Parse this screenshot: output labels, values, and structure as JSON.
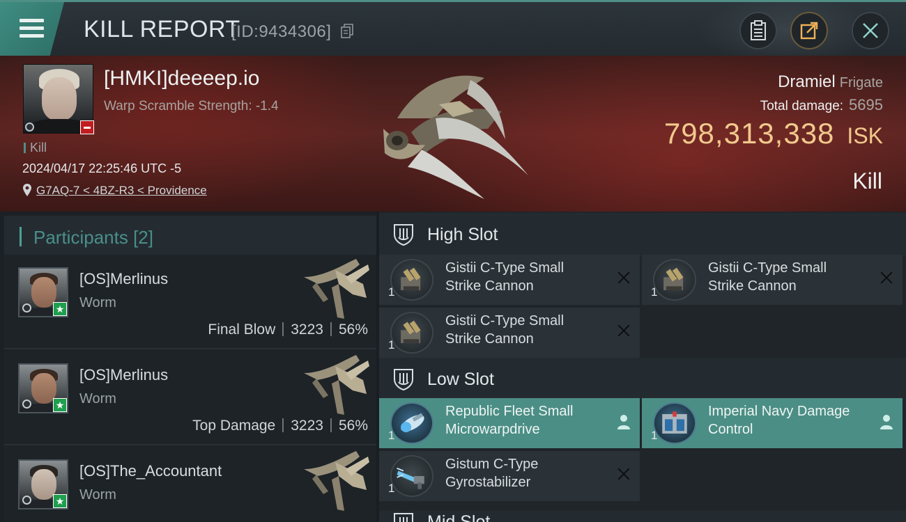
{
  "header": {
    "title": "KILL REPORT",
    "report_id": "[ID:9434306]"
  },
  "victim": {
    "name": "[HMKI]deeeep.io",
    "warp_scramble": "Warp Scramble Strength: -1.4",
    "kill_label": "Kill",
    "timestamp": "2024/04/17 22:25:46 UTC -5",
    "location": "G7AQ-7 < 4BZ-R3 < Providence",
    "ship_name": "Dramiel",
    "ship_class": "Frigate",
    "total_damage_label": "Total damage:",
    "total_damage": "5695",
    "isk_value": "798,313,338",
    "isk_unit": "ISK",
    "result": "Kill",
    "standing_color": "#c21d20"
  },
  "participants": {
    "title": "Participants",
    "count": "[2]",
    "rows": [
      {
        "name": "[OS]Merlinus",
        "ship": "Worm",
        "role": "Final Blow",
        "damage": "3223",
        "percent": "56%"
      },
      {
        "name": "[OS]Merlinus",
        "ship": "Worm",
        "role": "Top Damage",
        "damage": "3223",
        "percent": "56%"
      },
      {
        "name": "[OS]The_Accountant",
        "ship": "Worm"
      }
    ]
  },
  "fitting": {
    "high_slot_label": "High Slot",
    "low_slot_label": "Low Slot",
    "mid_slot_label": "Mid Slot",
    "high_slot": [
      {
        "qty": "1",
        "name": "Gistii C-Type Small Strike Cannon",
        "state": "destroyed"
      },
      {
        "qty": "1",
        "name": "Gistii C-Type Small Strike Cannon",
        "state": "destroyed"
      },
      {
        "qty": "1",
        "name": "Gistii C-Type Small Strike Cannon",
        "state": "destroyed"
      }
    ],
    "low_slot": [
      {
        "qty": "1",
        "name": "Republic Fleet Small Microwarpdrive",
        "state": "dropped"
      },
      {
        "qty": "1",
        "name": "Imperial Navy Damage Control",
        "state": "dropped"
      },
      {
        "qty": "1",
        "name": "Gistum C-Type Gyrostabilizer",
        "state": "destroyed"
      }
    ]
  },
  "colors": {
    "accent": "#4f8f86",
    "isk": "#f2c98d",
    "dropped_bg": "#4b8e85"
  }
}
